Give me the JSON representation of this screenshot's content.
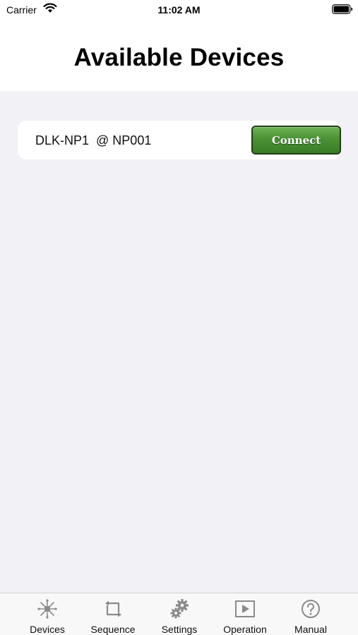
{
  "status_bar": {
    "carrier": "Carrier",
    "time": "11:02 AM"
  },
  "header": {
    "title": "Available Devices"
  },
  "devices": [
    {
      "name": "DLK-NP1  @ NP001",
      "action_label": "Connect"
    }
  ],
  "tabs": [
    {
      "label": "Devices",
      "icon": "devices-icon"
    },
    {
      "label": "Sequence",
      "icon": "sequence-icon"
    },
    {
      "label": "Settings",
      "icon": "gears-icon"
    },
    {
      "label": "Operation",
      "icon": "play-icon"
    },
    {
      "label": "Manual",
      "icon": "help-icon"
    }
  ],
  "colors": {
    "background": "#f1f1f6",
    "connect_button": "#4b9134",
    "icon_gray": "#8a8a8a"
  }
}
